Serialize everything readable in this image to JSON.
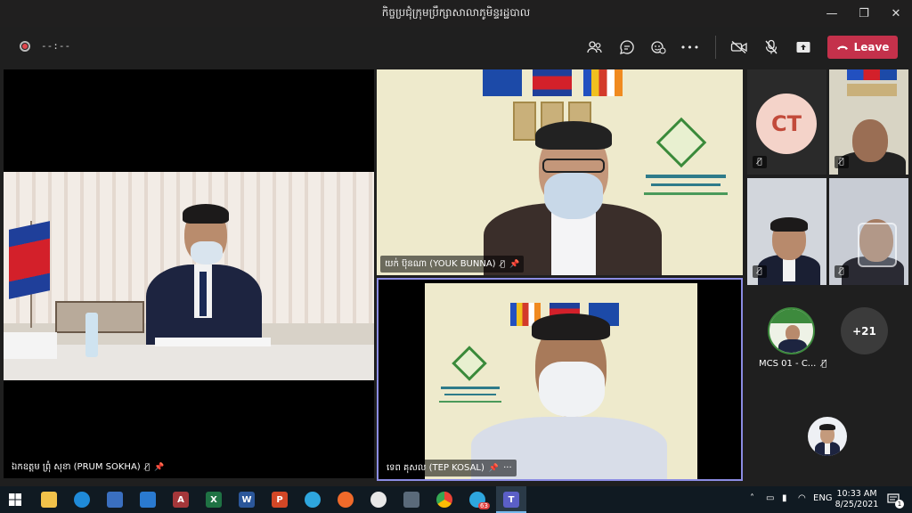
{
  "window": {
    "title": "កិច្ចប្រជុំក្រុមប្រឹក្សាសាលាភូមិន្ទរដ្ឋបាល",
    "controls": [
      "—",
      "❐",
      "✕"
    ]
  },
  "toolbar": {
    "timer": "--:--",
    "leave_label": "Leave",
    "icons": {
      "participants": "👥",
      "chat": "💬",
      "reactions": "☺",
      "more": "•••",
      "camera": "📹",
      "mic": "🎙",
      "share": "⬆"
    }
  },
  "tiles": {
    "main_left": {
      "name": "ឯកឧត្តម ព្រុំ សុខា (PRUM SOKHA)"
    },
    "top_right": {
      "name": "យក់ ប៊ុនណា (YOUK BUNNA)"
    },
    "bottom_right": {
      "name": "ទេព គុសល (TEP KOSAL)",
      "more": "···"
    }
  },
  "sidebar": {
    "ct_initials": "CT",
    "more_count": "+21",
    "mcs_label": "MCS 01 - C..."
  },
  "taskbar": {
    "apps": [
      "A",
      "X",
      "W",
      "P"
    ],
    "telegram_badge": "63",
    "lang": "ENG",
    "time": "10:33 AM",
    "date": "8/25/2021",
    "notif_count": "1"
  },
  "colors": {
    "leave": "#c4314b",
    "active_border": "#8b8ce3",
    "cream_bg": "#eeeacc"
  }
}
